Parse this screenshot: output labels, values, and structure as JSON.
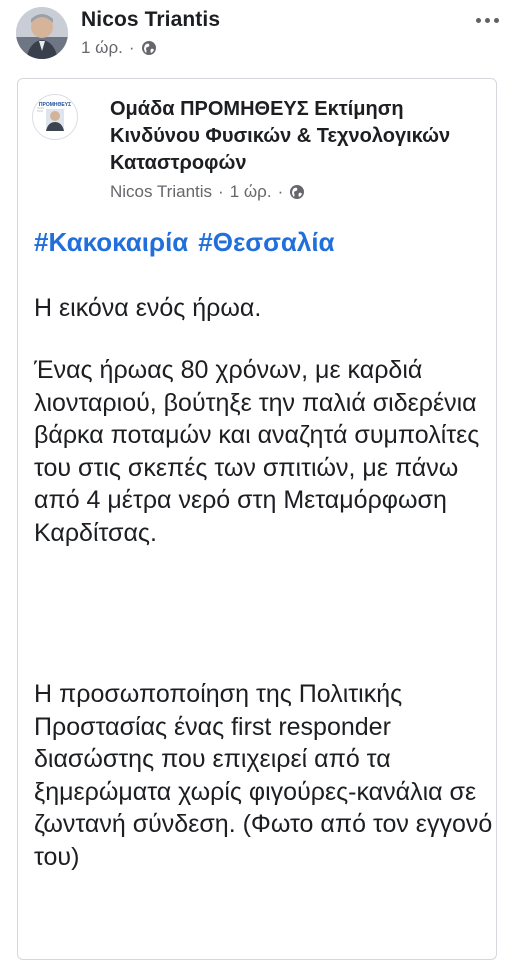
{
  "post": {
    "author": "Nicos Triantis",
    "time": "1 ώρ.",
    "separator": "·"
  },
  "shared": {
    "page_name": "Ομάδα ΠΡΟΜΗΘΕΥΣ Εκτίμηση Κινδύνου Φυσικών & Τεχνολογικών Καταστροφών",
    "thumb_text": "ΠΡΟΜΗΘΕΥΣ",
    "meta_author": "Nicos Triantis",
    "meta_time": "1 ώρ.",
    "separator": "·",
    "hashtags": [
      "#Κακοκαιρία",
      "#Θεσσαλία"
    ],
    "paragraphs": [
      "Η εικόνα ενός ήρωα.",
      "Ένας ήρωας 80 χρόνων, με καρδιά λιονταριού, βούτηξε την παλιά σιδερένια βάρκα ποταμών και αναζητά συμπολίτες του στις σκεπές των σπιτιών, με πάνω από 4 μέτρα νερό στη Μεταμόρφωση Καρδίτσας.",
      "Η προσωποποίηση της Πολιτικής Προστασίας ένας first responder διασώστης που επιχειρεί από τα ξημερώματα χωρίς φιγούρες-κανάλια σε ζωντανή σύνδεση. (Φωτο από τον εγγονό του)"
    ]
  },
  "colors": {
    "hashtag": "#216fdb",
    "meta": "#65676b",
    "text": "#1c1e21"
  },
  "icons": {
    "privacy": "globe-icon",
    "more": "more-options-icon",
    "author_avatar": "avatar",
    "page_logo": "page-logo"
  }
}
